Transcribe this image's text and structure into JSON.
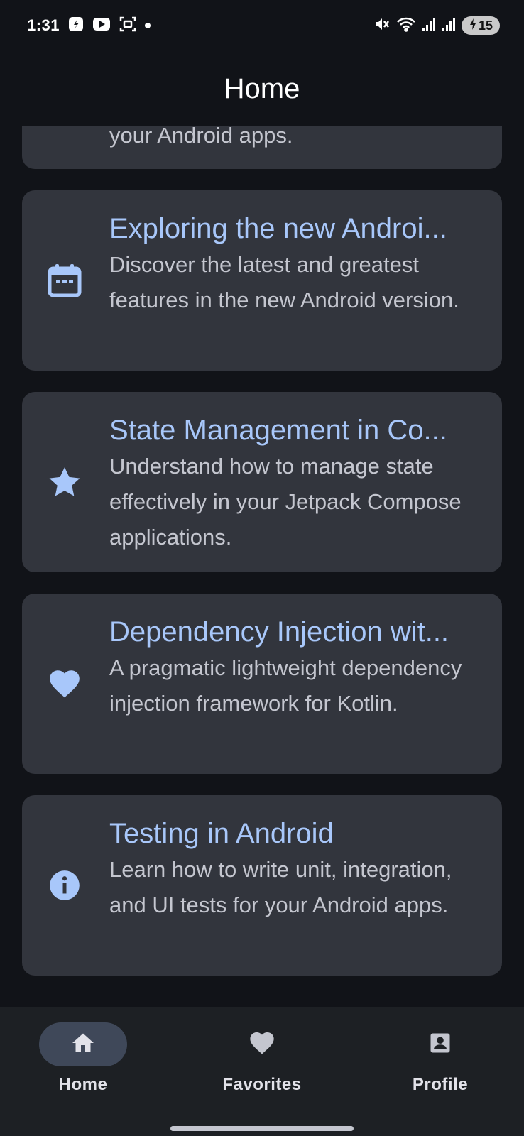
{
  "status_bar": {
    "time": "1:31",
    "battery": "15",
    "icons": [
      "shazam-icon",
      "youtube-icon",
      "screenshot-icon",
      "dot-icon",
      "mute-icon",
      "wifi-icon",
      "signal-icon",
      "signal-icon",
      "battery-charging-icon"
    ]
  },
  "top_bar": {
    "title": "Home"
  },
  "cards": [
    {
      "icon": "partial",
      "title": "",
      "description": "your Android apps."
    },
    {
      "icon": "calendar-icon",
      "title": "Exploring the new Androi...",
      "description": "Discover the latest and greatest features in the new Android version."
    },
    {
      "icon": "star-icon",
      "title": "State Management in Co...",
      "description": "Understand how to manage state effectively in your Jetpack Compose applications."
    },
    {
      "icon": "heart-icon",
      "title": "Dependency Injection wit...",
      "description": "A pragmatic lightweight dependency injection framework for Kotlin."
    },
    {
      "icon": "info-icon",
      "title": "Testing in Android",
      "description": "Learn how to write unit, integration, and UI tests for your Android apps."
    }
  ],
  "bottom_nav": {
    "items": [
      {
        "label": "Home",
        "icon": "home-icon",
        "active": true
      },
      {
        "label": "Favorites",
        "icon": "heart-icon",
        "active": false
      },
      {
        "label": "Profile",
        "icon": "profile-icon",
        "active": false
      }
    ]
  },
  "colors": {
    "background": "#111318",
    "card": "#32353d",
    "accent": "#a8c7fa",
    "nav_background": "#1d2024",
    "nav_indicator": "#3f4859"
  }
}
